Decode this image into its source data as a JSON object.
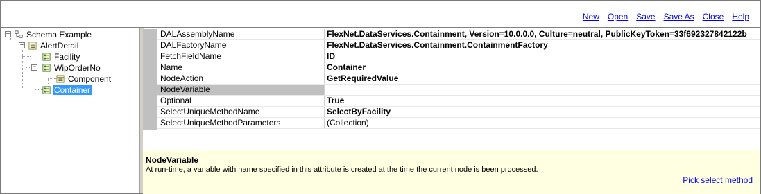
{
  "menu": {
    "new": "New",
    "open": "Open",
    "save": "Save",
    "save_as": "Save As",
    "close": "Close",
    "help": "Help"
  },
  "tree": {
    "root": "Schema Example",
    "alert_detail": "AlertDetail",
    "facility": "Facility",
    "wip_order_no": "WipOrderNo",
    "component": "Component",
    "container": "Container"
  },
  "properties": [
    {
      "name": "DALAssemblyName",
      "value": "FlexNet.DataServices.Containment, Version=10.0.0.0, Culture=neutral, PublicKeyToken=33f692327842122b"
    },
    {
      "name": "DALFactoryName",
      "value": "FlexNet.DataServices.Containment.ContainmentFactory"
    },
    {
      "name": "FetchFieldName",
      "value": "ID"
    },
    {
      "name": "Name",
      "value": "Container"
    },
    {
      "name": "NodeAction",
      "value": "GetRequiredValue"
    },
    {
      "name": "NodeVariable",
      "value": ""
    },
    {
      "name": "Optional",
      "value": "True"
    },
    {
      "name": "SelectUniqueMethodName",
      "value": "SelectByFacility"
    },
    {
      "name": "SelectUniqueMethodParameters",
      "value": "(Collection)"
    }
  ],
  "help": {
    "title": "NodeVariable",
    "description": "At run-time, a variable with name specified in this attribute is created at the time the current node is been processed.",
    "link": "Pick select method"
  }
}
